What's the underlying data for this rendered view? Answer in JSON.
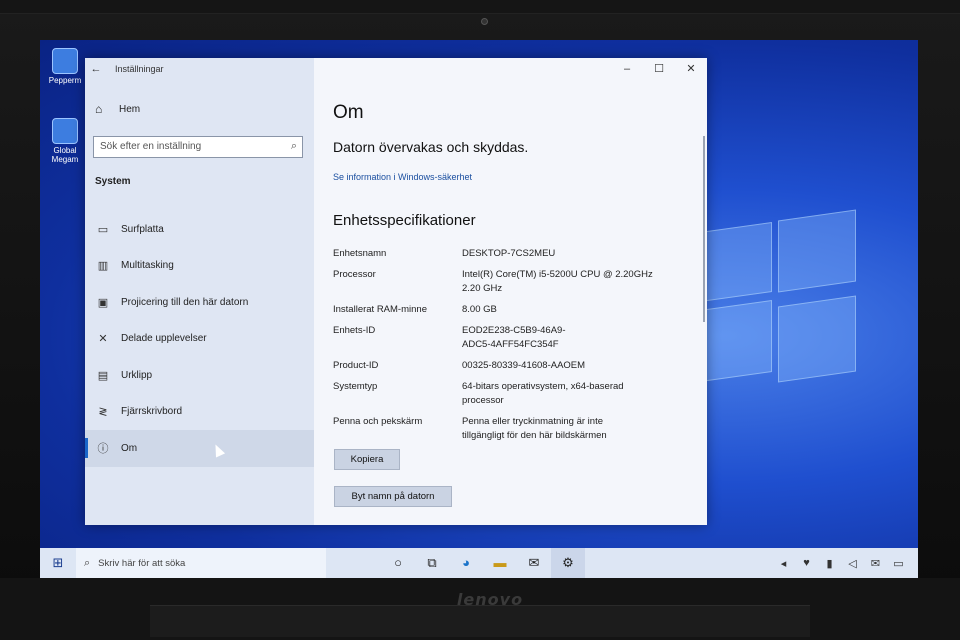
{
  "settings_window": {
    "title": "Inställningar",
    "sidebar": {
      "home_label": "Hem",
      "search_placeholder": "Sök efter en inställning",
      "section_title": "System",
      "items": [
        {
          "label": "Surfplatta",
          "icon": "tablet-icon"
        },
        {
          "label": "Multitasking",
          "icon": "multitasking-icon"
        },
        {
          "label": "Projicering till den här datorn",
          "icon": "projection-icon"
        },
        {
          "label": "Delade upplevelser",
          "icon": "shared-experiences-icon"
        },
        {
          "label": "Urklipp",
          "icon": "clipboard-icon"
        },
        {
          "label": "Fjärrskrivbord",
          "icon": "remote-desktop-icon"
        },
        {
          "label": "Om",
          "icon": "info-icon",
          "active": true
        }
      ]
    },
    "main": {
      "heading": "Om",
      "protection_status": "Datorn övervakas och skyddas.",
      "security_link": "Se information i Windows-säkerhet",
      "specs_heading": "Enhetsspecifikationer",
      "specs": [
        {
          "label": "Enhetsnamn",
          "value": "DESKTOP-7CS2MEU"
        },
        {
          "label": "Processor",
          "value": "Intel(R) Core(TM) i5-5200U CPU @ 2.20GHz\n2.20 GHz"
        },
        {
          "label": "Installerat RAM-minne",
          "value": "8.00 GB"
        },
        {
          "label": "Enhets-ID",
          "value": "EOD2E238-C5B9-46A9-\nADC5-4AFF54FC354F"
        },
        {
          "label": "Product-ID",
          "value": "00325-80339-41608-AAOEM"
        },
        {
          "label": "Systemtyp",
          "value": "64-bitars operativsystem, x64-baserad\nprocessor"
        },
        {
          "label": "Penna och pekskärm",
          "value": "Penna eller tryckinmatning är inte\ntillgängligt för den här bildskärmen"
        }
      ],
      "copy_button": "Kopiera",
      "rename_button": "Byt namn på datorn"
    }
  },
  "desktop_icons": [
    {
      "label": "Pepperm",
      "icon": "app-icon"
    },
    {
      "label": "Global\nMegam",
      "icon": "app-icon"
    }
  ],
  "taskbar": {
    "search_placeholder": "Skriv här för att söka",
    "icons": [
      "cortana-icon",
      "task-view-icon",
      "edge-icon",
      "file-explorer-icon",
      "mail-icon",
      "settings-icon"
    ]
  },
  "laptop_brand": "lenovo"
}
